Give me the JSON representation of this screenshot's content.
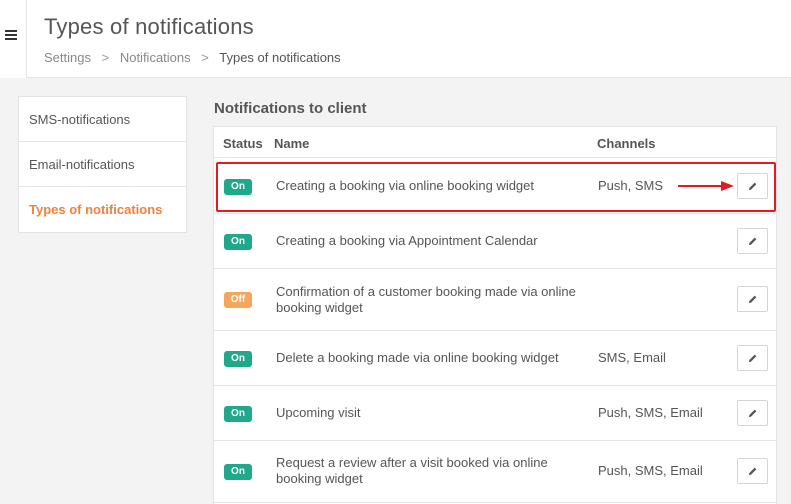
{
  "header": {
    "menu_icon": "hamburger-menu-icon",
    "title": "Types of notifications",
    "breadcrumb": [
      "Settings",
      "Notifications",
      "Types of notifications"
    ],
    "breadcrumb_separator": ">"
  },
  "sidebar": {
    "items": [
      {
        "label": "SMS-notifications",
        "active": false
      },
      {
        "label": "Email-notifications",
        "active": false
      },
      {
        "label": "Types of notifications",
        "active": true
      }
    ],
    "active_color": "#f0813b"
  },
  "main": {
    "section_title": "Notifications to client",
    "table": {
      "columns": [
        "Status",
        "Name",
        "Channels"
      ],
      "rows": [
        {
          "status": "On",
          "name": "Creating a booking via online booking widget",
          "channels": "Push, SMS",
          "highlighted": true
        },
        {
          "status": "On",
          "name": "Creating a booking via Appointment Calendar",
          "channels": ""
        },
        {
          "status": "Off",
          "name": "Confirmation of a customer booking made via online booking widget",
          "channels": ""
        },
        {
          "status": "On",
          "name": "Delete a booking made via online booking widget",
          "channels": "SMS, Email"
        },
        {
          "status": "On",
          "name": "Upcoming visit",
          "channels": "Push, SMS, Email"
        },
        {
          "status": "On",
          "name": "Request a review after a visit booked via online booking widget",
          "channels": "Push, SMS, Email"
        }
      ],
      "edit_icon": "pencil-icon"
    }
  },
  "colors": {
    "status_on": "#1fa98a",
    "status_off": "#f4a65c",
    "annotation": "#e01b22"
  }
}
